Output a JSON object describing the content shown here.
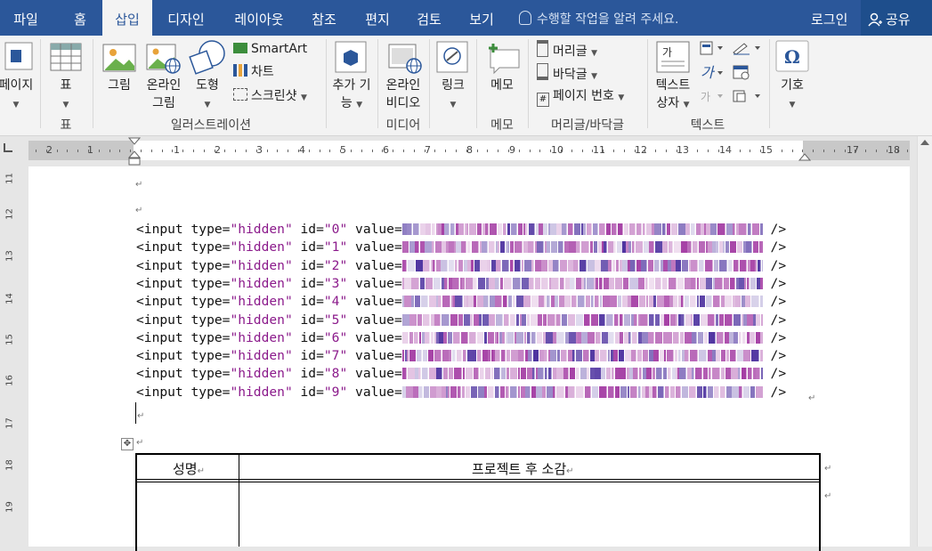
{
  "tabs": [
    {
      "label": "파일",
      "active": false
    },
    {
      "label": "홈",
      "active": false
    },
    {
      "label": "삽입",
      "active": true
    },
    {
      "label": "디자인",
      "active": false
    },
    {
      "label": "레이아웃",
      "active": false
    },
    {
      "label": "참조",
      "active": false
    },
    {
      "label": "편지",
      "active": false
    },
    {
      "label": "검토",
      "active": false
    },
    {
      "label": "보기",
      "active": false
    }
  ],
  "tell_me": "수행할 작업을 알려 주세요.",
  "login": "로그인",
  "share": "공유",
  "ribbon": {
    "pages_label": "페이지",
    "table_label": "표",
    "picture_label": "그림",
    "online_picture_l1": "온라인",
    "online_picture_l2": "그림",
    "shapes_label": "도형",
    "smartart_label": "SmartArt",
    "chart_label": "차트",
    "screenshot_label": "스크린샷",
    "addin_l1": "추가 기",
    "addin_l2": "능",
    "online_video_l1": "온라인",
    "online_video_l2": "비디오",
    "link_label": "링크",
    "comment_label": "메모",
    "header_label": "머리글",
    "footer_label": "바닥글",
    "page_number_label": "페이지 번호",
    "textbox_l1": "텍스트",
    "textbox_l2": "상자",
    "symbol_label": "기호",
    "groups": {
      "table": "표",
      "illustrations": "일러스트레이션",
      "media": "미디어",
      "comments": "메모",
      "header_footer": "머리글/바닥글",
      "text": "텍스트"
    }
  },
  "ruler": {
    "h_numbers": [
      "2",
      "1",
      "1",
      "2",
      "3",
      "4",
      "5",
      "6",
      "7",
      "8",
      "9",
      "10",
      "11",
      "12",
      "13",
      "14",
      "15",
      "17",
      "18"
    ],
    "v_numbers": [
      "11",
      "12",
      "13",
      "14",
      "15",
      "16",
      "17",
      "18",
      "19"
    ]
  },
  "document": {
    "input_lines": [
      {
        "prefix": "<input type=",
        "type": "\"hidden\"",
        "id_attr": " id=",
        "id": "\"0\"",
        "value_attr": " value=",
        "end": "/>"
      },
      {
        "prefix": "<input type=",
        "type": "\"hidden\"",
        "id_attr": " id=",
        "id": "\"1\"",
        "value_attr": " value=",
        "end": "/>"
      },
      {
        "prefix": "<input type=",
        "type": "\"hidden\"",
        "id_attr": " id=",
        "id": "\"2\"",
        "value_attr": " value=",
        "end": "/>"
      },
      {
        "prefix": "<input type=",
        "type": "\"hidden\"",
        "id_attr": " id=",
        "id": "\"3\"",
        "value_attr": " value=",
        "end": "/>"
      },
      {
        "prefix": "<input type=",
        "type": "\"hidden\"",
        "id_attr": " id=",
        "id": "\"4\"",
        "value_attr": " value=",
        "end": "/>"
      },
      {
        "prefix": "<input type=",
        "type": "\"hidden\"",
        "id_attr": " id=",
        "id": "\"5\"",
        "value_attr": " value=",
        "end": "/>"
      },
      {
        "prefix": "<input type=",
        "type": "\"hidden\"",
        "id_attr": " id=",
        "id": "\"6\"",
        "value_attr": " value=",
        "end": "/>"
      },
      {
        "prefix": "<input type=",
        "type": "\"hidden\"",
        "id_attr": " id=",
        "id": "\"7\"",
        "value_attr": " value=",
        "end": "/>"
      },
      {
        "prefix": "<input type=",
        "type": "\"hidden\"",
        "id_attr": " id=",
        "id": "\"8\"",
        "value_attr": " value=",
        "end": "/>"
      },
      {
        "prefix": "<input type=",
        "type": "\"hidden\"",
        "id_attr": " id=",
        "id": "\"9\"",
        "value_attr": " value=",
        "end": "/>"
      }
    ],
    "table_headers": [
      "성명",
      "프로젝트 후 소감"
    ]
  },
  "colors": {
    "title_bar": "#2b579a",
    "share_bg": "#1e4e8c",
    "attr_string": "#8b1a8b",
    "blur": "#9b2a9b"
  }
}
